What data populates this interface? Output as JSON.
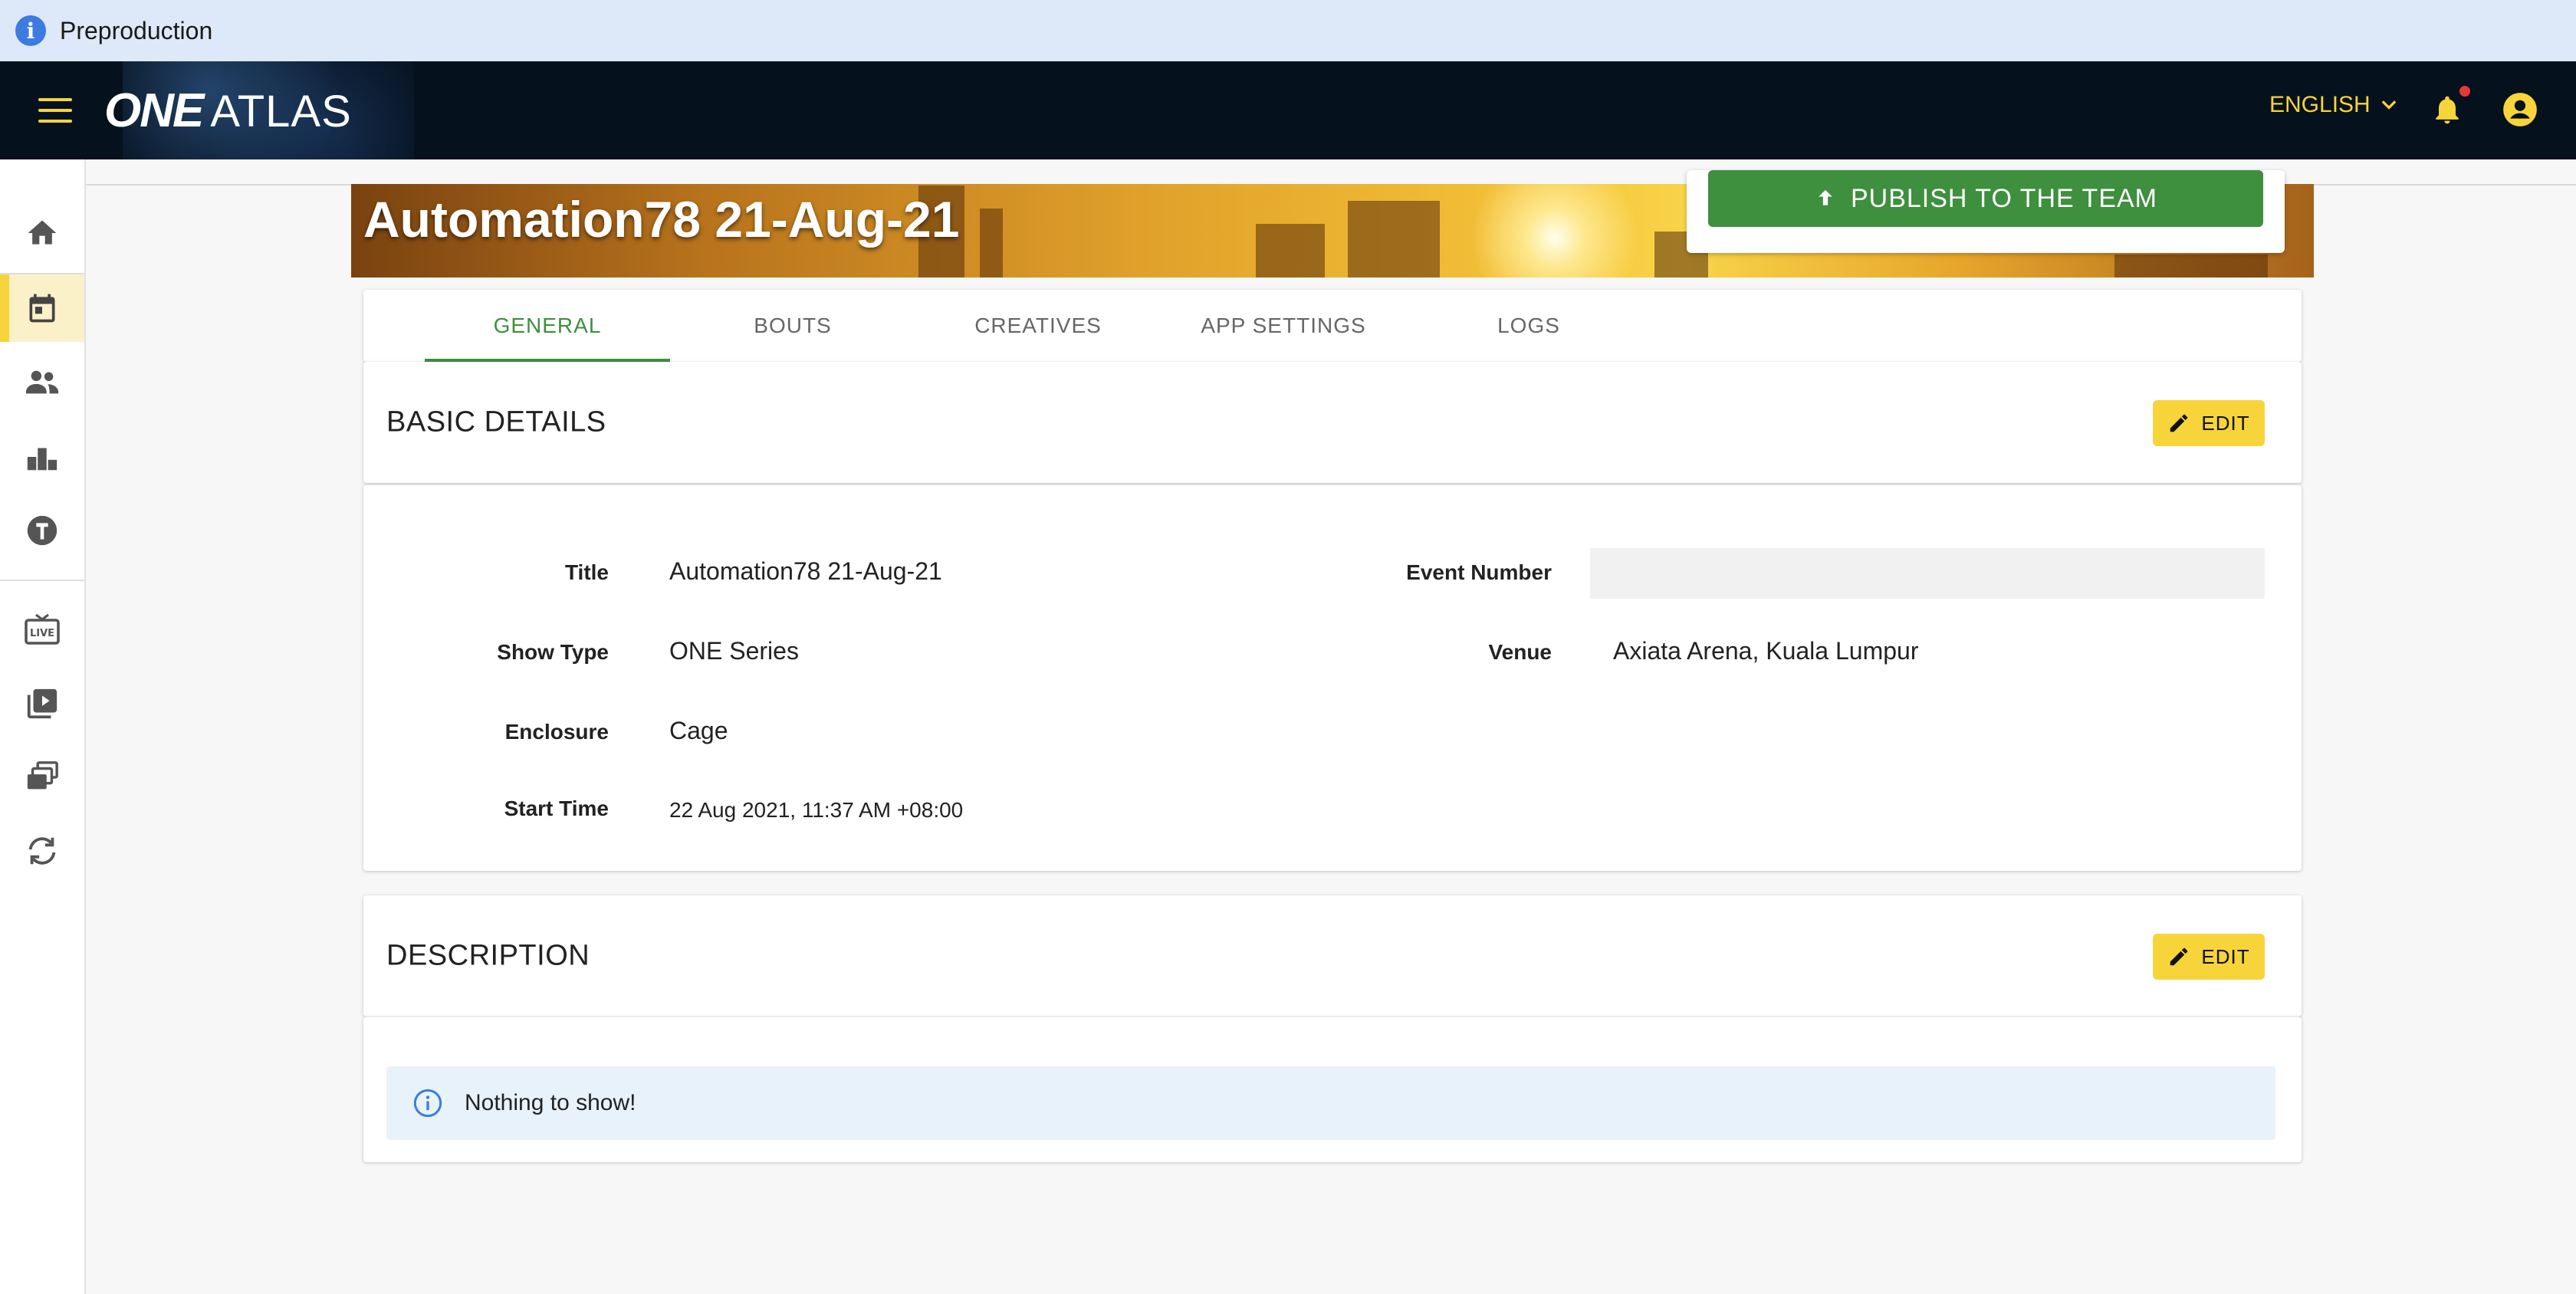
{
  "env_banner": {
    "text": "Preproduction"
  },
  "appbar": {
    "logo_one": "ONE",
    "logo_atlas": "ATLAS",
    "language": "ENGLISH"
  },
  "event": {
    "title": "Automation78 21-Aug-21",
    "publish_label": "PUBLISH TO THE TEAM"
  },
  "tabs": [
    {
      "label": "GENERAL",
      "active": true
    },
    {
      "label": "BOUTS"
    },
    {
      "label": "CREATIVES"
    },
    {
      "label": "APP SETTINGS"
    },
    {
      "label": "LOGS"
    }
  ],
  "basic_details": {
    "heading": "BASIC DETAILS",
    "edit_label": "EDIT",
    "fields": {
      "title_label": "Title",
      "title_value": "Automation78 21-Aug-21",
      "show_type_label": "Show Type",
      "show_type_value": "ONE Series",
      "enclosure_label": "Enclosure",
      "enclosure_value": "Cage",
      "start_time_label": "Start Time",
      "start_time_value": "22 Aug 2021, 11:37 AM +08:00",
      "event_number_label": "Event Number",
      "event_number_value": "",
      "venue_label": "Venue",
      "venue_value": "Axiata Arena, Kuala Lumpur"
    }
  },
  "description": {
    "heading": "DESCRIPTION",
    "edit_label": "EDIT",
    "empty_message": "Nothing to show!"
  },
  "sidebar": {
    "items": [
      {
        "icon": "home-icon"
      },
      {
        "icon": "calendar-icon",
        "active": true
      },
      {
        "icon": "people-icon"
      },
      {
        "icon": "podium-icon"
      },
      {
        "icon": "shield-icon"
      },
      {
        "icon": "live-tv-icon"
      },
      {
        "icon": "video-library-icon"
      },
      {
        "icon": "gallery-icon"
      },
      {
        "icon": "sync-icon"
      }
    ]
  },
  "colors": {
    "accent_yellow": "#f7d43a",
    "accent_green": "#3e8f3e",
    "appbar_bg": "#06111e",
    "info_blue": "#3d7be0"
  }
}
